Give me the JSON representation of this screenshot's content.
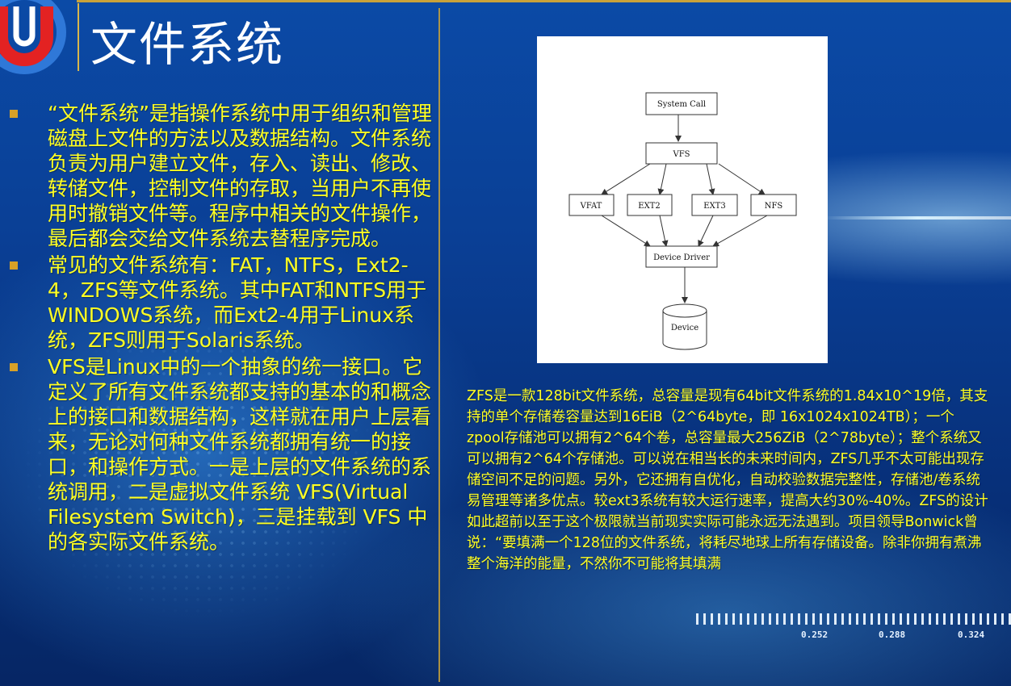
{
  "slide": {
    "title": "文件系统",
    "bullets": [
      "“文件系统”是指操作系统中用于组织和管理磁盘上文件的方法以及数据结构。文件系统负责为用户建立文件，存入、读出、修改、转储文件，控制文件的存取，当用户不再使用时撤销文件等。程序中相关的文件操作，最后都会交给文件系统去替程序完成。",
      "常见的文件系统有：FAT，NTFS，Ext2-4，ZFS等文件系统。其中FAT和NTFS用于WINDOWS系统，而Ext2-4用于Linux系统，ZFS则用于Solaris系统。",
      "VFS是Linux中的一个抽象的统一接口。它定义了所有文件系统都支持的基本的和概念上的接口和数据结构，这样就在用户上层看来，无论对何种文件系统都拥有统一的接口，和操作方式。一是上层的文件系统的系统调用，二是虚拟文件系统 VFS(Virtual Filesystem Switch)，三是挂载到 VFS 中的各实际文件系统。"
    ],
    "zfs_paragraph": "ZFS是一款128bit文件系统，总容量是现有64bit文件系统的1.84x10^19倍，其支持的单个存储卷容量达到16EiB（2^64byte，即 16x1024x1024TB）；一个zpool存储池可以拥有2^64个卷，总容量最大256ZiB（2^78byte）；整个系统又可以拥有2^64个存储池。可以说在相当长的未来时间内，ZFS几乎不太可能出现存储空间不足的问题。另外，它还拥有自优化，自动校验数据完整性，存储池/卷系统易管理等诸多优点。较ext3系统有较大运行速率，提高大约30%-40%。ZFS的设计如此超前以至于这个极限就当前现实实际可能永远无法遇到。项目领导Bonwick曾说：“要填满一个128位的文件系统，将耗尽地球上所有存储设备。除非你拥有煮沸整个海洋的能量，不然你不可能将其填满"
  },
  "diagram": {
    "system_call": "System Call",
    "vfs": "VFS",
    "filesystems": [
      "VFAT",
      "EXT2",
      "EXT3",
      "NFS"
    ],
    "device_driver": "Device Driver",
    "device": "Device"
  },
  "background": {
    "scale_labels": [
      "0.252",
      "0.288",
      "0.324"
    ]
  },
  "colors": {
    "text_yellow": "#ffff22",
    "bullet_marker": "#d8a127",
    "background_blue": "#0a3f95",
    "divider_gold": "#c9a23a"
  },
  "icons": {
    "logo": "u-logo",
    "bullet": "square-bullet-icon"
  }
}
